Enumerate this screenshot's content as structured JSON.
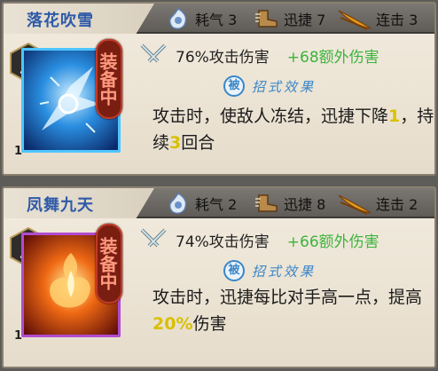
{
  "cards": [
    {
      "name": "落花吹雪",
      "stats": [
        {
          "icon": "qi-icon",
          "text": "耗气 3"
        },
        {
          "icon": "speed-boot-icon",
          "text": "迅捷 7"
        },
        {
          "icon": "combo-slash-icon",
          "text": "连击 3"
        }
      ],
      "equipped_stamp": "装备中",
      "slot_number": "1",
      "damage": "76%攻击伤害",
      "extra_damage": "+68额外伤害",
      "effect_seal": "被",
      "effect_label": "招式效果",
      "desc_parts": [
        "攻击时，使敌人冻结，迅捷下降",
        "1",
        "，持续",
        "3",
        "回合"
      ],
      "art_color": "#3a9be6"
    },
    {
      "name": "凤舞九天",
      "stats": [
        {
          "icon": "qi-icon",
          "text": "耗气 2"
        },
        {
          "icon": "speed-boot-icon",
          "text": "迅捷 8"
        },
        {
          "icon": "combo-slash-icon",
          "text": "连击 2"
        }
      ],
      "equipped_stamp": "装备中",
      "slot_number": "1",
      "damage": "74%攻击伤害",
      "extra_damage": "+66额外伤害",
      "effect_seal": "被",
      "effect_label": "招式效果",
      "desc_parts": [
        "攻击时，迅捷每比对手高一点，提高",
        "20%",
        "伤害"
      ],
      "art_color": "#e8561c"
    }
  ]
}
